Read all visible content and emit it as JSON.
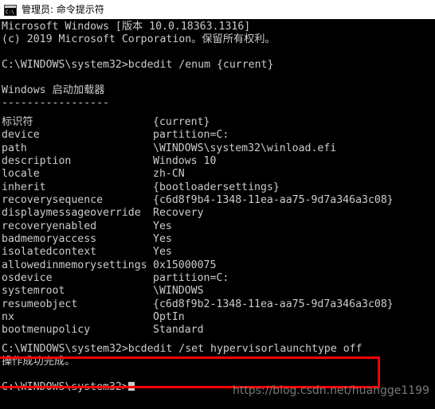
{
  "titlebar": {
    "icon": "cmd-icon",
    "title": "管理员: 命令提示符"
  },
  "console": {
    "header_lines": [
      "Microsoft Windows [版本 10.0.18363.1316]",
      "(c) 2019 Microsoft Corporation。保留所有权利。",
      "",
      "C:\\WINDOWS\\system32>bcdedit /enum {current}",
      "",
      "Windows 启动加载器",
      "-----------------"
    ],
    "properties": [
      {
        "key": "标识符",
        "value": "{current}"
      },
      {
        "key": "device",
        "value": "partition=C:"
      },
      {
        "key": "path",
        "value": "\\WINDOWS\\system32\\winload.efi"
      },
      {
        "key": "description",
        "value": "Windows 10"
      },
      {
        "key": "locale",
        "value": "zh-CN"
      },
      {
        "key": "inherit",
        "value": "{bootloadersettings}"
      },
      {
        "key": "recoverysequence",
        "value": "{c6d8f9b4-1348-11ea-aa75-9d7a346a3c08}"
      },
      {
        "key": "displaymessageoverride",
        "value": "Recovery"
      },
      {
        "key": "recoveryenabled",
        "value": "Yes"
      },
      {
        "key": "badmemoryaccess",
        "value": "Yes"
      },
      {
        "key": "isolatedcontext",
        "value": "Yes"
      },
      {
        "key": "allowedinmemorysettings",
        "value": "0x15000075"
      },
      {
        "key": "osdevice",
        "value": "partition=C:"
      },
      {
        "key": "systemroot",
        "value": "\\WINDOWS"
      },
      {
        "key": "resumeobject",
        "value": "{c6d8f9b2-1348-11ea-aa75-9d7a346a3c08}"
      },
      {
        "key": "nx",
        "value": "OptIn"
      },
      {
        "key": "bootmenupolicy",
        "value": "Standard"
      }
    ],
    "highlighted_command": "C:\\WINDOWS\\system32>bcdedit /set hypervisorlaunchtype off",
    "highlighted_result": "操作成功完成。",
    "final_prompt": "C:\\WINDOWS\\system32>"
  },
  "annotation": {
    "box_color": "#ff0000"
  },
  "watermark": {
    "text": "https://blog.csdn.net/huangge1199"
  }
}
